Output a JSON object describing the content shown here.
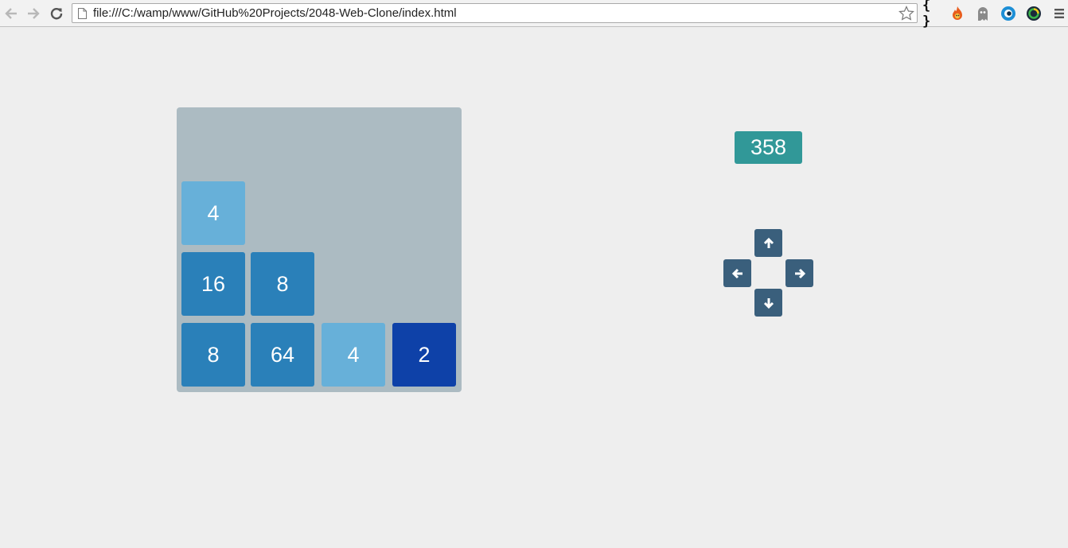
{
  "browser": {
    "url": "file:///C:/wamp/www/GitHub%20Projects/2048-Web-Clone/index.html",
    "extension_glyph": "{ }",
    "icons": {
      "back": "back-arrow-icon",
      "forward": "forward-arrow-icon",
      "reload": "reload-icon",
      "page": "page-icon",
      "bookmark": "star-icon",
      "braces": "braces-icon",
      "fire": "fire-icon",
      "ghost": "ghost-icon",
      "eye": "eye-icon",
      "circle": "circle-icon",
      "menu": "menu-icon"
    }
  },
  "game": {
    "board": {
      "rows": [
        [
          "",
          "",
          "",
          ""
        ],
        [
          "4",
          "",
          "",
          ""
        ],
        [
          "16",
          "8",
          "",
          ""
        ],
        [
          "8",
          "64",
          "4",
          "2"
        ]
      ]
    },
    "score": "358",
    "controls": {
      "up": "arrow-up-icon",
      "left": "arrow-left-icon",
      "right": "arrow-right-icon",
      "down": "arrow-down-icon"
    }
  },
  "colors": {
    "background": "#eeeeee",
    "board": "#acbbc2",
    "tile_4": "#67b0d9",
    "tile_8_16_64": "#2a80b9",
    "tile_2": "#0e41a8",
    "score_badge": "#319898",
    "control_button": "#3a5f7c"
  }
}
